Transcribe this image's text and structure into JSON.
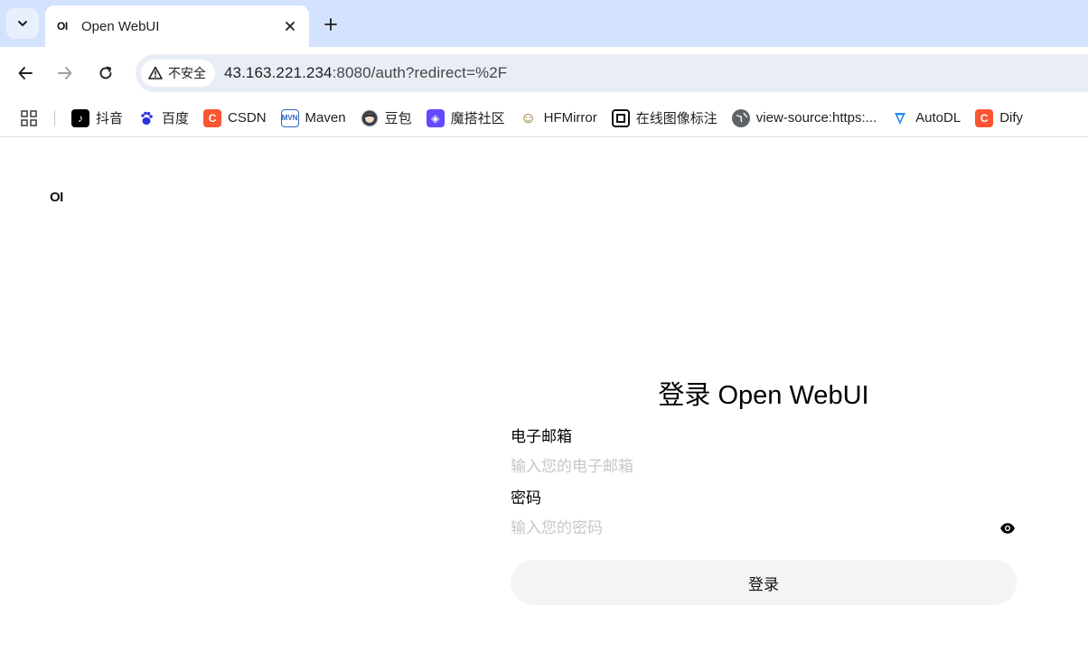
{
  "browser": {
    "tab": {
      "favicon_text": "OI",
      "title": "Open WebUI"
    },
    "security_label": "不安全",
    "url": {
      "host": "43.163.221.234",
      "rest": ":8080/auth?redirect=%2F"
    },
    "bookmarks": [
      {
        "label": "抖音",
        "icon": "tiktok-icon",
        "color": "#000000",
        "glyph": "♪"
      },
      {
        "label": "百度",
        "icon": "baidu-paw-icon",
        "color": "#ffffff",
        "glyph": ""
      },
      {
        "label": "CSDN",
        "icon": "csdn-icon",
        "color": "#fc5531",
        "glyph": "C"
      },
      {
        "label": "Maven",
        "icon": "maven-icon",
        "color": "#ffffff",
        "glyph": "MVN"
      },
      {
        "label": "豆包",
        "icon": "doubao-avatar-icon",
        "color": "#dfe3ea",
        "glyph": ""
      },
      {
        "label": "魔搭社区",
        "icon": "modelscope-icon",
        "color": "#624aff",
        "glyph": "◈"
      },
      {
        "label": "HFMirror",
        "icon": "hugging-face-icon",
        "color": "#ffd21e",
        "glyph": "☺"
      },
      {
        "label": "在线图像标注",
        "icon": "annotation-icon",
        "color": "#111111",
        "glyph": "▣"
      },
      {
        "label": "view-source:https:...",
        "icon": "globe-icon",
        "color": "#5f6368",
        "glyph": ""
      },
      {
        "label": "AutoDL",
        "icon": "autodl-icon",
        "color": "#ffffff",
        "glyph": ""
      },
      {
        "label": "Dify",
        "icon": "dify-icon",
        "color": "#fc5531",
        "glyph": "C"
      }
    ]
  },
  "page": {
    "logo": "OI",
    "heading": "登录 Open WebUI",
    "email_label": "电子邮箱",
    "email_placeholder": "输入您的电子邮箱",
    "password_label": "密码",
    "password_placeholder": "输入您的密码",
    "submit_label": "登录"
  }
}
